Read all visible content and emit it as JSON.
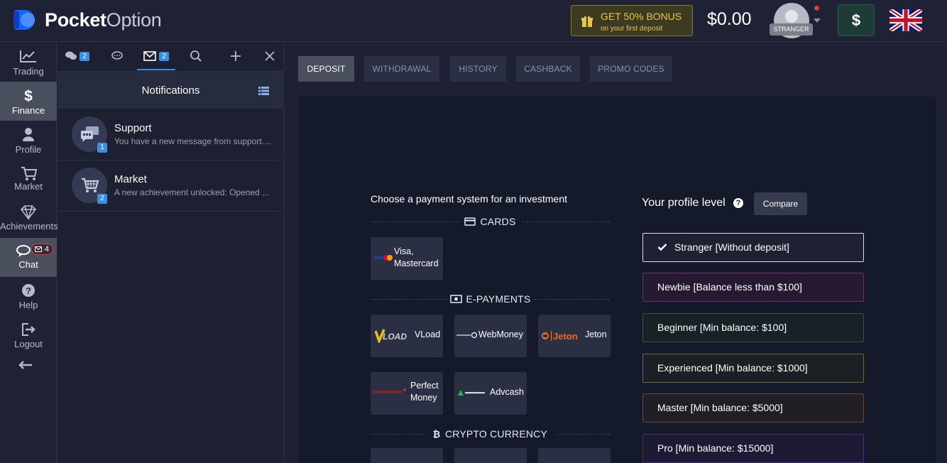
{
  "app": {
    "logo_bold": "Pocket",
    "logo_rest": "Option"
  },
  "header": {
    "bonus_main": "GET 50% BONUS",
    "bonus_sub": "on your first deposit",
    "balance": "$0.00",
    "avatar_badge": "STRANGER",
    "dollar_button": "$"
  },
  "leftnav": {
    "items": [
      {
        "label": "Trading",
        "icon": "chart-icon"
      },
      {
        "label": "Finance",
        "icon": "dollar-icon",
        "active": true
      },
      {
        "label": "Profile",
        "icon": "user-icon"
      },
      {
        "label": "Market",
        "icon": "cart-icon"
      },
      {
        "label": "Achievements",
        "icon": "diamond-icon"
      },
      {
        "label": "Chat",
        "icon": "chat-icon",
        "badge": "4"
      },
      {
        "label": "Help",
        "icon": "help-icon"
      },
      {
        "label": "Logout",
        "icon": "logout-icon"
      }
    ]
  },
  "panel": {
    "tab_badges": {
      "chats": "2",
      "mail": "2"
    },
    "title": "Notifications",
    "notifications": [
      {
        "title": "Support",
        "message": "You have a new message from support....",
        "count": "1",
        "icon": "support-chat-icon"
      },
      {
        "title": "Market",
        "message": "A new achievement unlocked: Opened ...",
        "count": "2",
        "icon": "cart-icon"
      }
    ]
  },
  "main": {
    "tabs": [
      "DEPOSIT",
      "WITHDRAWAL",
      "HISTORY",
      "CASHBACK",
      "PROMO CODES"
    ],
    "active_tab": "DEPOSIT",
    "choose_text": "Choose a payment system for an investment",
    "sections": {
      "cards": "CARDS",
      "epayments": "E-PAYMENTS",
      "crypto": "CRYPTO CURRENCY"
    },
    "cards": [
      {
        "name_line1": "Visa,",
        "name_line2": "Mastercard"
      }
    ],
    "epayments": [
      {
        "name": "VLoad",
        "logo_text": "VLOAD"
      },
      {
        "name": "WebMoney",
        "logo_text": "WebMoney"
      },
      {
        "name": "Jeton",
        "logo_text": "Jeton"
      },
      {
        "name_line1": "Perfect",
        "name_line2": "Money",
        "logo_text": "Perfect Money"
      },
      {
        "name": "Advcash",
        "logo_text": "ADVcash"
      }
    ],
    "profile": {
      "title": "Your profile level",
      "help": "?",
      "compare": "Compare",
      "levels": [
        {
          "label": "Stranger [Without deposit]",
          "color": "#e0e0e0",
          "bg": "#1d2132",
          "selected": true
        },
        {
          "label": "Newbie [Balance less than $100]",
          "color": "#7b2a6e",
          "bg": "#251a30"
        },
        {
          "label": "Beginner [Min balance: $100]",
          "color": "#2f5a3e",
          "bg": "#182226"
        },
        {
          "label": "Experienced [Min balance: $1000]",
          "color": "#6b6a33",
          "bg": "#1c1f26"
        },
        {
          "label": "Master [Min balance: $5000]",
          "color": "#6a4a2e",
          "bg": "#211e25"
        },
        {
          "label": "Pro [Min balance: $15000]",
          "color": "#4a2f80",
          "bg": "#1d1a35"
        }
      ]
    }
  }
}
